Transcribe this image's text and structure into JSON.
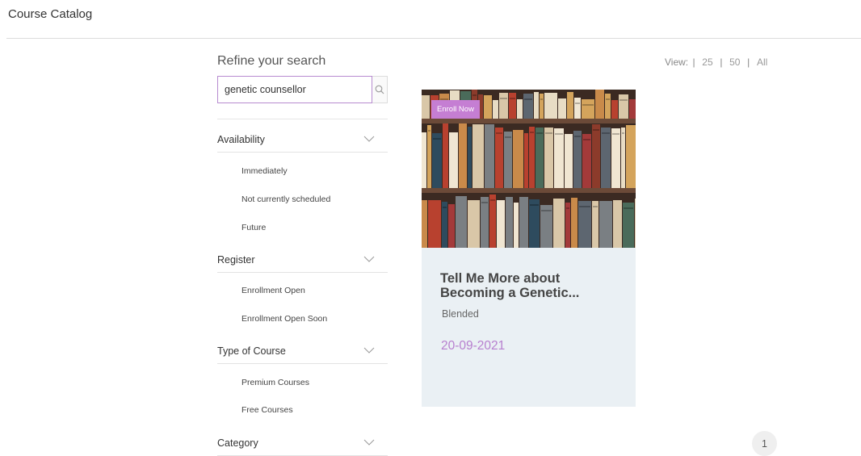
{
  "header": {
    "title": "Course Catalog"
  },
  "search": {
    "heading": "Refine your search",
    "value": "genetic counsellor",
    "icon": "search-icon"
  },
  "view": {
    "label": "View:",
    "options": [
      "25",
      "50",
      "All"
    ],
    "sep": "|"
  },
  "filters": [
    {
      "label": "Availability",
      "options": [
        "Immediately",
        "Not currently scheduled",
        "Future"
      ]
    },
    {
      "label": "Register",
      "options": [
        "Enrollment Open",
        "Enrollment Open Soon"
      ]
    },
    {
      "label": "Type of Course",
      "options": [
        "Premium Courses",
        "Free Courses"
      ]
    },
    {
      "label": "Category",
      "options": []
    }
  ],
  "card": {
    "badge": "Enroll Now",
    "title": "Tell Me More about Becoming a Genetic...",
    "type": "Blended",
    "date": "20-09-2021"
  },
  "pagination": {
    "current": "1"
  },
  "colors": {
    "accent": "#c57ed3",
    "date": "#b77fcf",
    "card_bg": "#eaf0f4"
  }
}
